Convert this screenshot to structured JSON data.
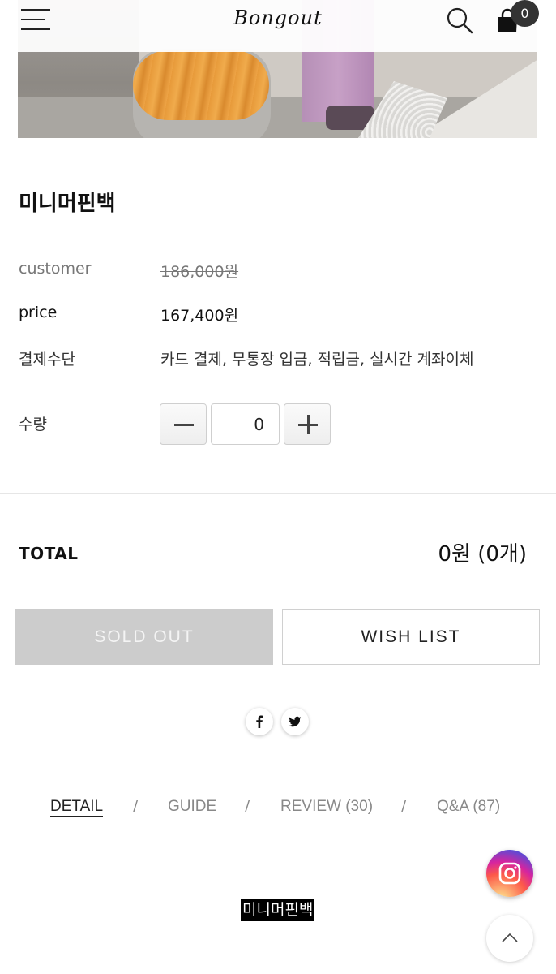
{
  "header": {
    "logo_text": "Bongout",
    "cart_count": "0"
  },
  "product": {
    "title": "미니머핀백",
    "customer_label": "customer",
    "customer_price": "186,000원",
    "price_label": "price",
    "price": "167,400원",
    "payment_label": "결제수단",
    "payment_methods": "카드 결제, 무통장 입금, 적립금, 실시간 계좌이체",
    "quantity_label": "수량",
    "quantity_value": "0"
  },
  "total": {
    "label": "TOTAL",
    "value": "0원 (0개)"
  },
  "actions": {
    "sold_out_label": "SOLD OUT",
    "wish_list_label": "WISH LIST"
  },
  "tabs": [
    {
      "label": "DETAIL",
      "active": true
    },
    {
      "label": "GUIDE"
    },
    {
      "label": "REVIEW (30)"
    },
    {
      "label": "Q&A (87)"
    }
  ],
  "tab_separator": "/",
  "detail_caption": "미니머핀백",
  "icons": {
    "menu": "menu-icon",
    "search": "search-icon",
    "cart": "shopping-bag-icon",
    "facebook": "facebook-icon",
    "twitter": "twitter-icon",
    "instagram": "instagram-icon",
    "scroll_top": "chevron-up-icon"
  },
  "colors": {
    "sold_out_bg": "#cccccc",
    "badge_bg": "#333333"
  }
}
